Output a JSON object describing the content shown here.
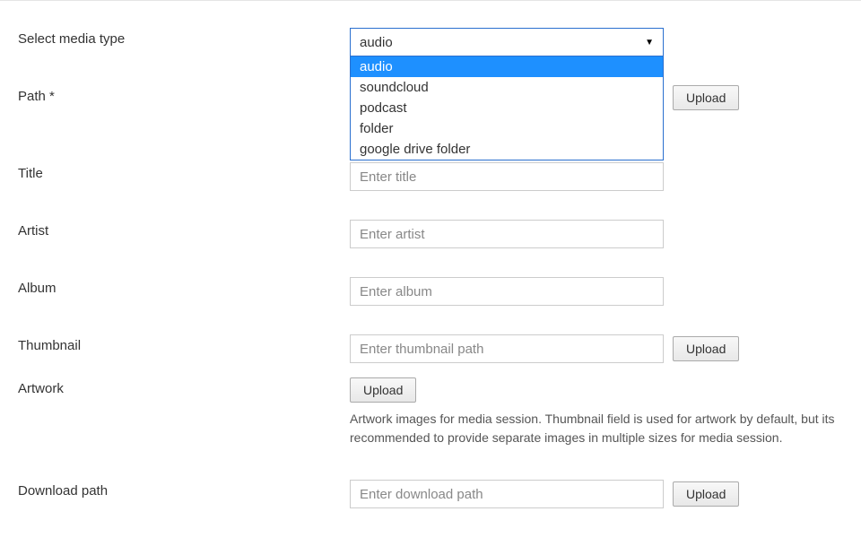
{
  "fields": {
    "media_type": {
      "label": "Select media type",
      "selected": "audio",
      "options": [
        "audio",
        "soundcloud",
        "podcast",
        "folder",
        "google drive folder"
      ]
    },
    "path": {
      "label": "Path *",
      "upload_label": "Upload"
    },
    "title": {
      "label": "Title",
      "placeholder": "Enter title"
    },
    "artist": {
      "label": "Artist",
      "placeholder": "Enter artist"
    },
    "album": {
      "label": "Album",
      "placeholder": "Enter album"
    },
    "thumbnail": {
      "label": "Thumbnail",
      "placeholder": "Enter thumbnail path",
      "upload_label": "Upload"
    },
    "artwork": {
      "label": "Artwork",
      "upload_label": "Upload",
      "help": "Artwork images for media session. Thumbnail field is used for artwork by default, but its recommended to provide separate images in multiple sizes for media session."
    },
    "download_path": {
      "label": "Download path",
      "placeholder": "Enter download path",
      "upload_label": "Upload"
    }
  }
}
